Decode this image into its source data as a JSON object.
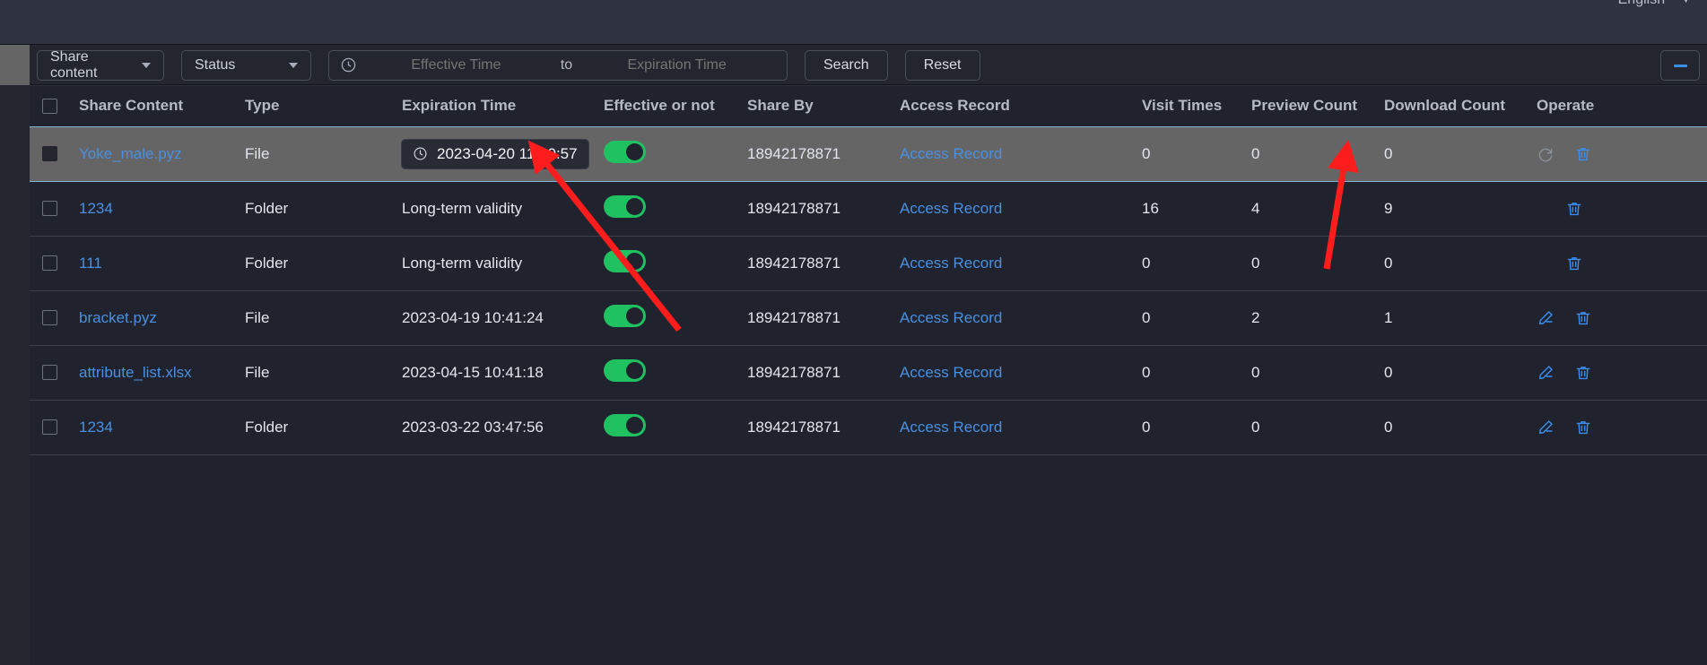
{
  "header": {
    "language_label": "English",
    "language_caret_icon": "chevron-down-icon"
  },
  "filters": {
    "share_content_select": {
      "label": "Share content",
      "caret_icon": "chevron-down-icon"
    },
    "status_select": {
      "label": "Status",
      "caret_icon": "chevron-down-icon"
    },
    "date_range": {
      "clock_icon": "clock-icon",
      "start_placeholder": "Effective Time",
      "start_value": "",
      "separator": "to",
      "end_placeholder": "Expiration Time",
      "end_value": ""
    },
    "search_button": "Search",
    "reset_button": "Reset",
    "column_settings_button_icon": "column-settings-icon"
  },
  "table": {
    "columns": [
      "Share Content",
      "Type",
      "Expiration Time",
      "Effective or not",
      "Share By",
      "Access Record",
      "Visit Times",
      "Preview Count",
      "Download Count",
      "Operate"
    ],
    "select_all_icon": "checkbox-icon",
    "rows": [
      {
        "selected": true,
        "checkbox_state": "filled",
        "share_content": "Yoke_male.pyz",
        "type": "File",
        "expiration_time": "2023-04-20 11:00:57",
        "expiration_is_editor": true,
        "expiration_clock_icon": "clock-icon",
        "effective": true,
        "share_by": "18942178871",
        "access_record": "Access Record",
        "visit_times": "0",
        "preview_count": "0",
        "download_count": "0",
        "operations": [
          "reload-icon",
          "trash-icon"
        ]
      },
      {
        "selected": false,
        "checkbox_state": "empty",
        "share_content": "1234",
        "type": "Folder",
        "expiration_time": "Long-term validity",
        "expiration_is_editor": false,
        "effective": true,
        "share_by": "18942178871",
        "access_record": "Access Record",
        "visit_times": "16",
        "preview_count": "4",
        "download_count": "9",
        "operations": [
          "trash-icon"
        ]
      },
      {
        "selected": false,
        "checkbox_state": "empty",
        "share_content": "111",
        "type": "Folder",
        "expiration_time": "Long-term validity",
        "expiration_is_editor": false,
        "effective": true,
        "share_by": "18942178871",
        "access_record": "Access Record",
        "visit_times": "0",
        "preview_count": "0",
        "download_count": "0",
        "operations": [
          "trash-icon"
        ]
      },
      {
        "selected": false,
        "checkbox_state": "empty",
        "share_content": "bracket.pyz",
        "type": "File",
        "expiration_time": "2023-04-19 10:41:24",
        "expiration_is_editor": false,
        "effective": true,
        "share_by": "18942178871",
        "access_record": "Access Record",
        "visit_times": "0",
        "preview_count": "2",
        "download_count": "1",
        "operations": [
          "edit-icon",
          "trash-icon"
        ]
      },
      {
        "selected": false,
        "checkbox_state": "empty",
        "share_content": "attribute_list.xlsx",
        "type": "File",
        "expiration_time": "2023-04-15 10:41:18",
        "expiration_is_editor": false,
        "effective": true,
        "share_by": "18942178871",
        "access_record": "Access Record",
        "visit_times": "0",
        "preview_count": "0",
        "download_count": "0",
        "operations": [
          "edit-icon",
          "trash-icon"
        ]
      },
      {
        "selected": false,
        "checkbox_state": "empty",
        "share_content": "1234",
        "type": "Folder",
        "expiration_time": "2023-03-22 03:47:56",
        "expiration_is_editor": false,
        "effective": true,
        "share_by": "18942178871",
        "access_record": "Access Record",
        "visit_times": "0",
        "preview_count": "0",
        "download_count": "0",
        "operations": [
          "edit-icon",
          "trash-icon"
        ]
      }
    ]
  },
  "annotations": {
    "arrow_1": "red-arrow-pointing-to-expiration-time-editor",
    "arrow_2": "red-arrow-pointing-to-reload-operate-icon"
  },
  "colors": {
    "accent_link": "#4a90e2",
    "toggle_on": "#1fc161",
    "row_selected_bg": "#656565",
    "row_selected_border": "#8ab4d8",
    "annotation_red": "#fe1d1d",
    "page_bg": "#20232d"
  }
}
